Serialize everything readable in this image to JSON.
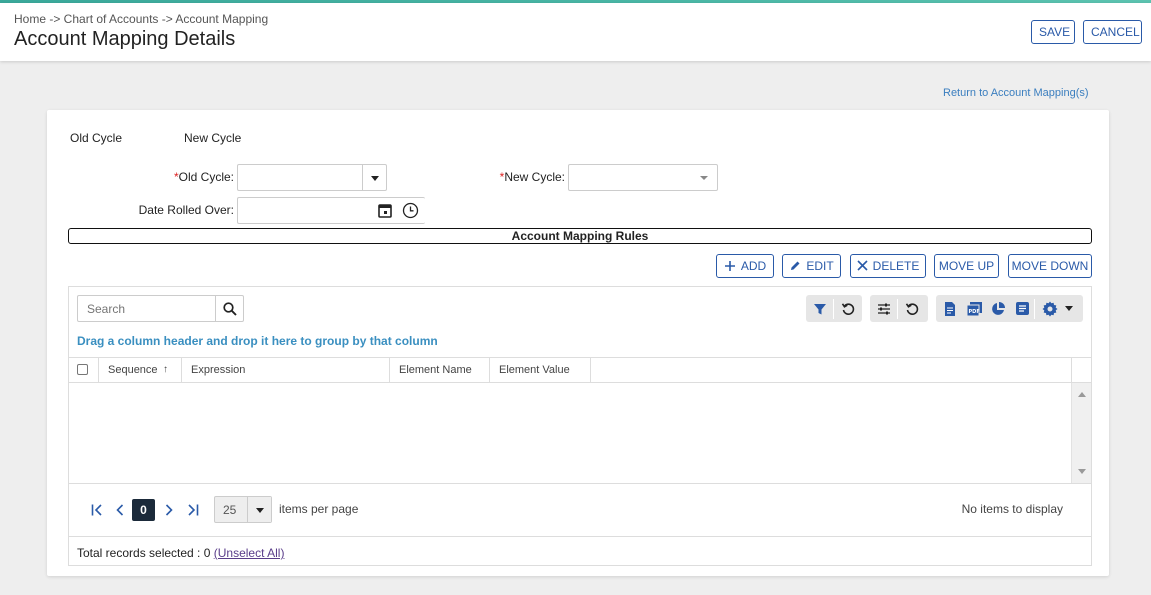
{
  "header": {
    "breadcrumb": "Home -> Chart of Accounts -> Account Mapping",
    "title": "Account Mapping Details",
    "save_label": "SAVE",
    "cancel_label": "CANCEL"
  },
  "return_link": "Return to Account Mapping(s)",
  "tabs": [
    "Old Cycle",
    "New Cycle"
  ],
  "form": {
    "old_cycle_label": "Old Cycle:",
    "old_cycle_value": "",
    "new_cycle_label": "New Cycle:",
    "new_cycle_value": "",
    "required_mark": "*",
    "date_rolled_label": "Date Rolled Over:",
    "date_rolled_value": ""
  },
  "section_title": "Account Mapping Rules",
  "actions": {
    "add": "ADD",
    "edit": "EDIT",
    "delete": "DELETE",
    "move_up": "MOVE UP",
    "move_down": "MOVE DOWN"
  },
  "grid": {
    "search_placeholder": "Search",
    "group_hint": "Drag a column header and drop it here to group by that column",
    "columns": [
      "Sequence",
      "Expression",
      "Element Name",
      "Element Value"
    ],
    "sort_indicator": "↑",
    "rows": [],
    "pager": {
      "current_page": "0",
      "page_size": "25",
      "items_per_page_label": "items per page",
      "empty_message": "No items to display"
    },
    "footer": {
      "total_label": "Total records selected : 0",
      "unselect_label": "(Unselect All)"
    }
  },
  "colors": {
    "accent": "#2a5aa8",
    "link": "#3a7ebf",
    "group_hint": "#3a8fc0",
    "toolbar_icon": "#2a5aa8",
    "required": "#dd2222",
    "current_page_bg": "#1b2a3a"
  },
  "icons": [
    "plus-icon",
    "pencil-icon",
    "close-icon",
    "search-icon",
    "filter-icon",
    "reset-icon",
    "sliders-icon",
    "document-icon",
    "pdf-icon",
    "pie-chart-icon",
    "list-icon",
    "gear-icon",
    "calendar-icon",
    "clock-icon"
  ]
}
